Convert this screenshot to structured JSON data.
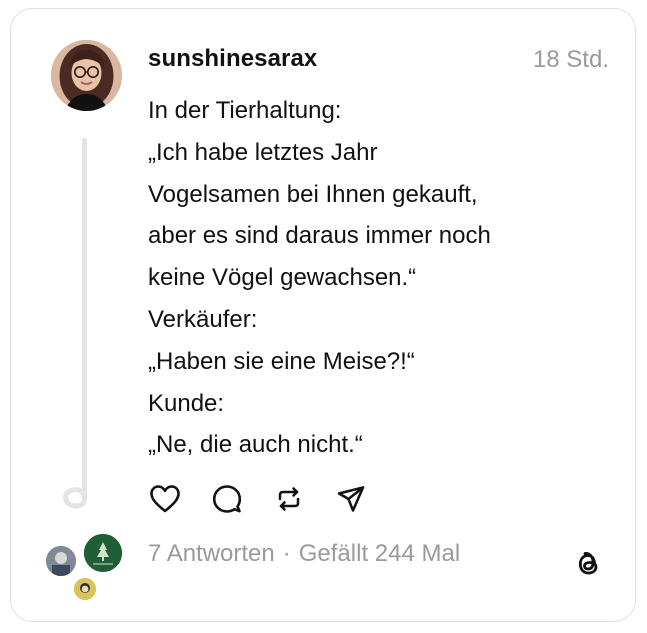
{
  "post": {
    "username": "sunshinesarax",
    "timestamp": "18 Std.",
    "body_lines": [
      "In der Tierhaltung:",
      "„Ich habe letztes Jahr",
      "Vogelsamen bei Ihnen gekauft,",
      "aber es sind daraus immer noch",
      "keine Vögel gewachsen.“",
      "Verkäufer:",
      "„Haben sie eine Meise?!“",
      "Kunde:",
      "„Ne, die auch nicht.“"
    ]
  },
  "actions": {
    "like_icon": "heart-icon",
    "reply_icon": "comment-icon",
    "repost_icon": "repost-icon",
    "share_icon": "send-icon"
  },
  "stats": {
    "replies": "7 Antworten",
    "separator": "·",
    "likes": "Gefällt 244 Mal"
  },
  "colors": {
    "text": "#111111",
    "muted": "#9a9a9a",
    "border": "#dedede",
    "thread_line": "#e4e4e4"
  }
}
